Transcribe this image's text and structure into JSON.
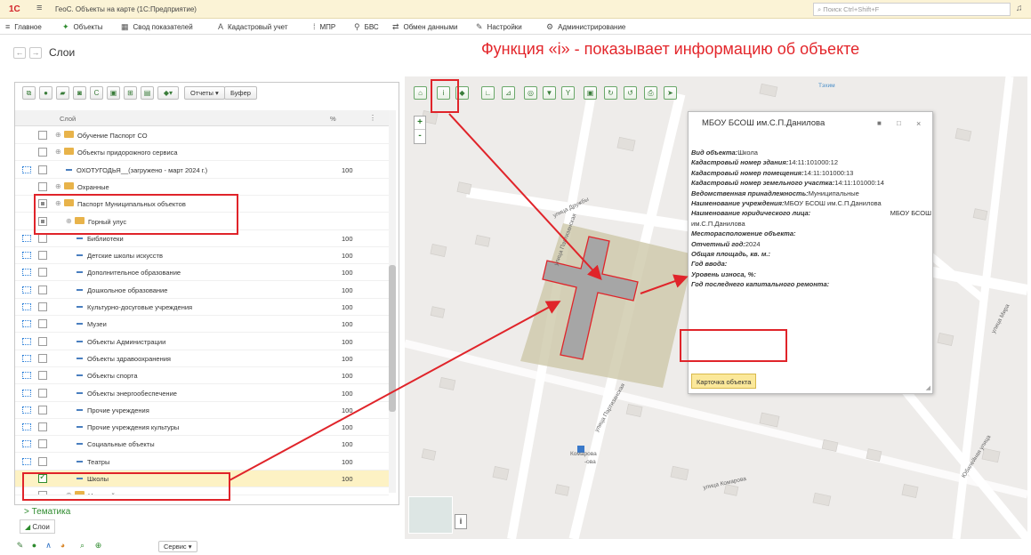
{
  "window": {
    "logo": "1С",
    "title": "ГеоС. Объекты на карте (1С:Предприятие)",
    "search_placeholder": "Поиск Ctrl+Shift+F"
  },
  "menu": [
    "Главное",
    "Объекты",
    "Свод показателей",
    "Кадастровый учет",
    "МПР",
    "БВС",
    "Обмен данными",
    "Настройки",
    "Администрирование"
  ],
  "page": {
    "title": "Слои",
    "caption": "Функция «i» - показывает информацию об объекте"
  },
  "layers_toolbar": {
    "reports": "Отчеты ▾",
    "buffer": "Буфер"
  },
  "layers_table": {
    "col_layer": "Слой",
    "col_pct": "%",
    "rows": [
      {
        "label": "Обучение Паспорт СО",
        "pct": ""
      },
      {
        "label": "Объекты придорожного сервиса",
        "pct": ""
      },
      {
        "label": "ОХОТУГОДЬЯ__(загружено - март 2024 г.)",
        "pct": "100"
      },
      {
        "label": "Охранные",
        "pct": ""
      },
      {
        "label": "Паспорт Муниципальных объектов",
        "pct": ""
      },
      {
        "label": "Горный улус",
        "pct": ""
      },
      {
        "label": "Библиотеки",
        "pct": "100"
      },
      {
        "label": "Детские школы искусств",
        "pct": "100"
      },
      {
        "label": "Дополнительное образование",
        "pct": "100"
      },
      {
        "label": "Дошкольное образование",
        "pct": "100"
      },
      {
        "label": "Культурно-досуговые учреждения",
        "pct": "100"
      },
      {
        "label": "Музеи",
        "pct": "100"
      },
      {
        "label": "Объекты Администрации",
        "pct": "100"
      },
      {
        "label": "Объекты здравоохранения",
        "pct": "100"
      },
      {
        "label": "Объекты спорта",
        "pct": "100"
      },
      {
        "label": "Объекты энергообеспечение",
        "pct": "100"
      },
      {
        "label": "Прочие учреждения",
        "pct": "100"
      },
      {
        "label": "Прочие учреждения культуры",
        "pct": "100"
      },
      {
        "label": "Социальные объекты",
        "pct": "100"
      },
      {
        "label": "Театры",
        "pct": "100"
      },
      {
        "label": "Школы",
        "pct": "100"
      },
      {
        "label": "Намский улус",
        "pct": ""
      }
    ]
  },
  "thematic": "> Тематика",
  "layers_tab": "Слои",
  "service_button": "Сервис ▾",
  "map_labels": {
    "druzhby": "улица Дружбы",
    "partizanskaya": "улица Партизанская",
    "komarova": "улица Комарова",
    "yubileynaya": "Юбилейная улица",
    "mira": "улица Мира",
    "komarova_poi": "Комарова",
    "poi_sub": "-ова",
    "top": "Тэхим"
  },
  "popup": {
    "title": "МБОУ БСОШ им.С.П.Данилова",
    "lines": [
      {
        "k": "Вид объекта:",
        "v": "Школа"
      },
      {
        "k": "Кадастровый номер здания:",
        "v": "14:11:101000:12"
      },
      {
        "k": "Кадастровый номер помещения:",
        "v": "14:11:101000:13"
      },
      {
        "k": "Кадастровый номер земельного участка:",
        "v": "14:11:101000:14"
      },
      {
        "k": "Ведомственная принадлежность:",
        "v": "Муниципальные"
      },
      {
        "k": "Наименование учреждения:",
        "v": "МБОУ БСОШ им.С.П.Данилова"
      },
      {
        "k": "Наименование юридического лица:",
        "v": "МБОУ БСОШ"
      },
      {
        "k": "",
        "v": "им.С.П.Данилова"
      },
      {
        "k": "Месторасположение объекта:",
        "v": ""
      },
      {
        "k": "Отчетный год:",
        "v": "2024"
      },
      {
        "k": "Общая площадь, кв. м.:",
        "v": ""
      },
      {
        "k": "Год ввода:",
        "v": ""
      },
      {
        "k": "Уровень износа, %:",
        "v": ""
      },
      {
        "k": "Год последнего капитального ремонта:",
        "v": ""
      }
    ],
    "card_button": "Карточка объекта"
  },
  "colors": {
    "highlight": "#e0242a",
    "accent_green": "#2e8b2e",
    "title_bar": "#fbf3d6",
    "selected_row": "#fdf2c4"
  }
}
